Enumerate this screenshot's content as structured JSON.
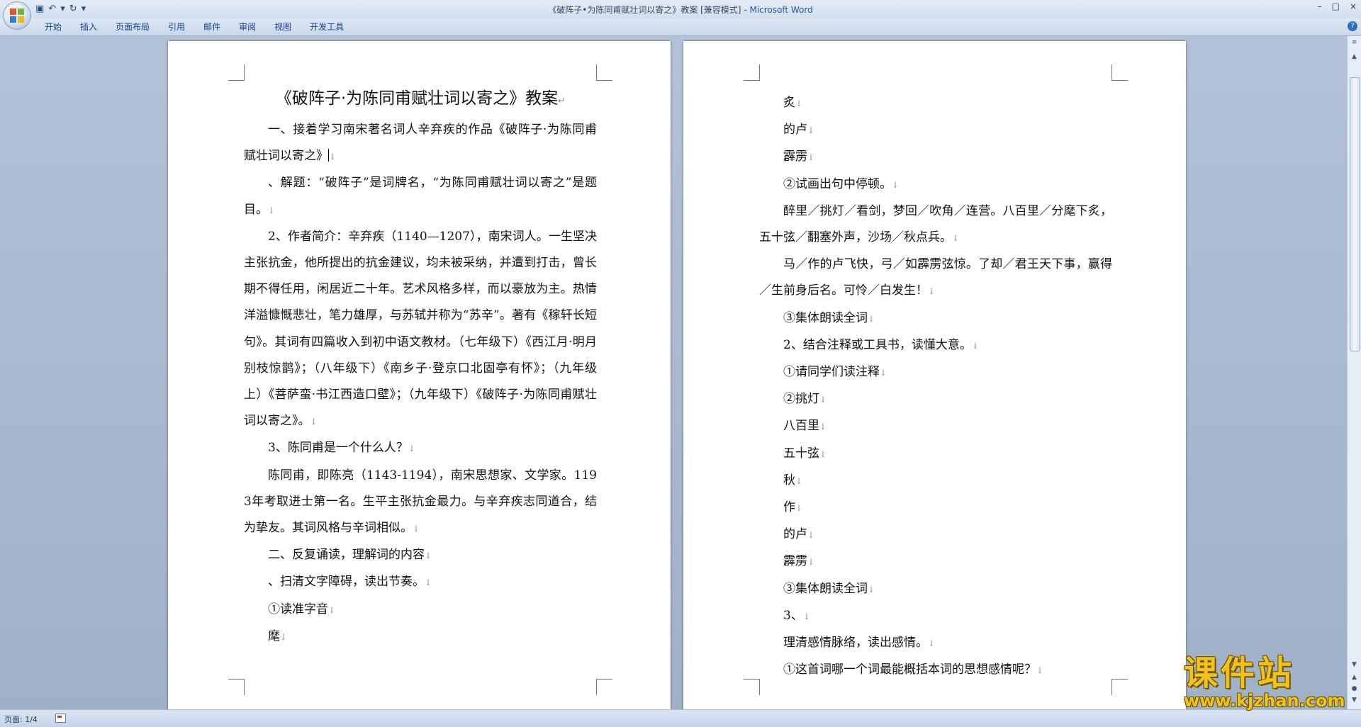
{
  "window": {
    "title_doc": "《破阵子•为陈同甫赋壮词以寄之》教案 [兼容模式]",
    "title_sep": " - ",
    "title_app": "Microsoft Word",
    "controls": [
      "–",
      "□",
      "×"
    ]
  },
  "quick_access": {
    "save_icon": "save-icon",
    "undo_icon": "undo-icon",
    "redo_icon": "redo-icon",
    "glyphs": [
      "▣",
      "↶",
      "▾",
      "↻",
      "▾"
    ]
  },
  "ribbon": {
    "tabs": [
      "开始",
      "插入",
      "页面布局",
      "引用",
      "邮件",
      "审阅",
      "视图",
      "开发工具"
    ],
    "help": "?"
  },
  "page1": {
    "title": "《破阵子·为陈同甫赋壮词以寄之》教案",
    "paragraphs": [
      "一、接着学习南宋著名词人辛弃疾的作品《破阵子·为陈同甫赋壮词以寄之》",
      "、解题：“破阵子”是词牌名，“为陈同甫赋壮词以寄之”是题目。",
      "2、作者简介：辛弃疾（1140—1207），南宋词人。一生坚决主张抗金，他所提出的抗金建议，均未被采纳，并遭到打击，曾长期不得任用，闲居近二十年。艺术风格多样，而以豪放为主。热情洋溢慷慨悲壮，笔力雄厚，与苏轼并称为“苏辛”。著有《稼轩长短句》。其词有四篇收入到初中语文教材。（七年级下）《西江月·明月别枝惊鹊》；（八年级下）《南乡子·登京口北固亭有怀》；（九年级上）《菩萨蛮·书江西造口壁》；（九年级下）《破阵子·为陈同甫赋壮词以寄之》。",
      "3、陈同甫是一个什么人？",
      "陈同甫，即陈亮（1143-1194），南宋思想家、文学家。1193年考取进士第一名。生平主张抗金最力。与辛弃疾志同道合，结为挚友。其词风格与辛词相似。",
      "二、反复诵读，理解词的内容",
      "、扫清文字障碍，读出节奏。",
      "①读准字音",
      "麾"
    ]
  },
  "page2": {
    "paragraphs": [
      "炙",
      "的卢",
      "霹雳",
      "②试画出句中停顿。",
      "醉里／挑灯／看剑，梦回／吹角／连营。八百里／分麾下炙，五十弦／翻塞外声，沙场／秋点兵。",
      "马／作的卢飞快，弓／如霹雳弦惊。了却／君王天下事，赢得／生前身后名。可怜／白发生！",
      "③集体朗读全词",
      "2、结合注释或工具书，读懂大意。",
      "①请同学们读注释",
      "②挑灯",
      "八百里",
      "五十弦",
      "秋",
      "作",
      "的卢",
      "霹雳",
      "③集体朗读全词",
      "3、",
      "理清感情脉络，读出感情。",
      "①这首词哪一个词最能概括本词的思想感情呢？"
    ]
  },
  "marks": {
    "paragraph": "↓",
    "title_end": "↵",
    "cursor_tail": "↓"
  },
  "scrollbar": {
    "up": "▲",
    "down": "▼",
    "browse_up": "▲",
    "browse_select": "●",
    "browse_down": "▼",
    "top_icon": "≡"
  },
  "status": {
    "page": "页面: 1/4"
  },
  "watermark": {
    "text": "课件站",
    "url": "www.kjzhan.com"
  }
}
